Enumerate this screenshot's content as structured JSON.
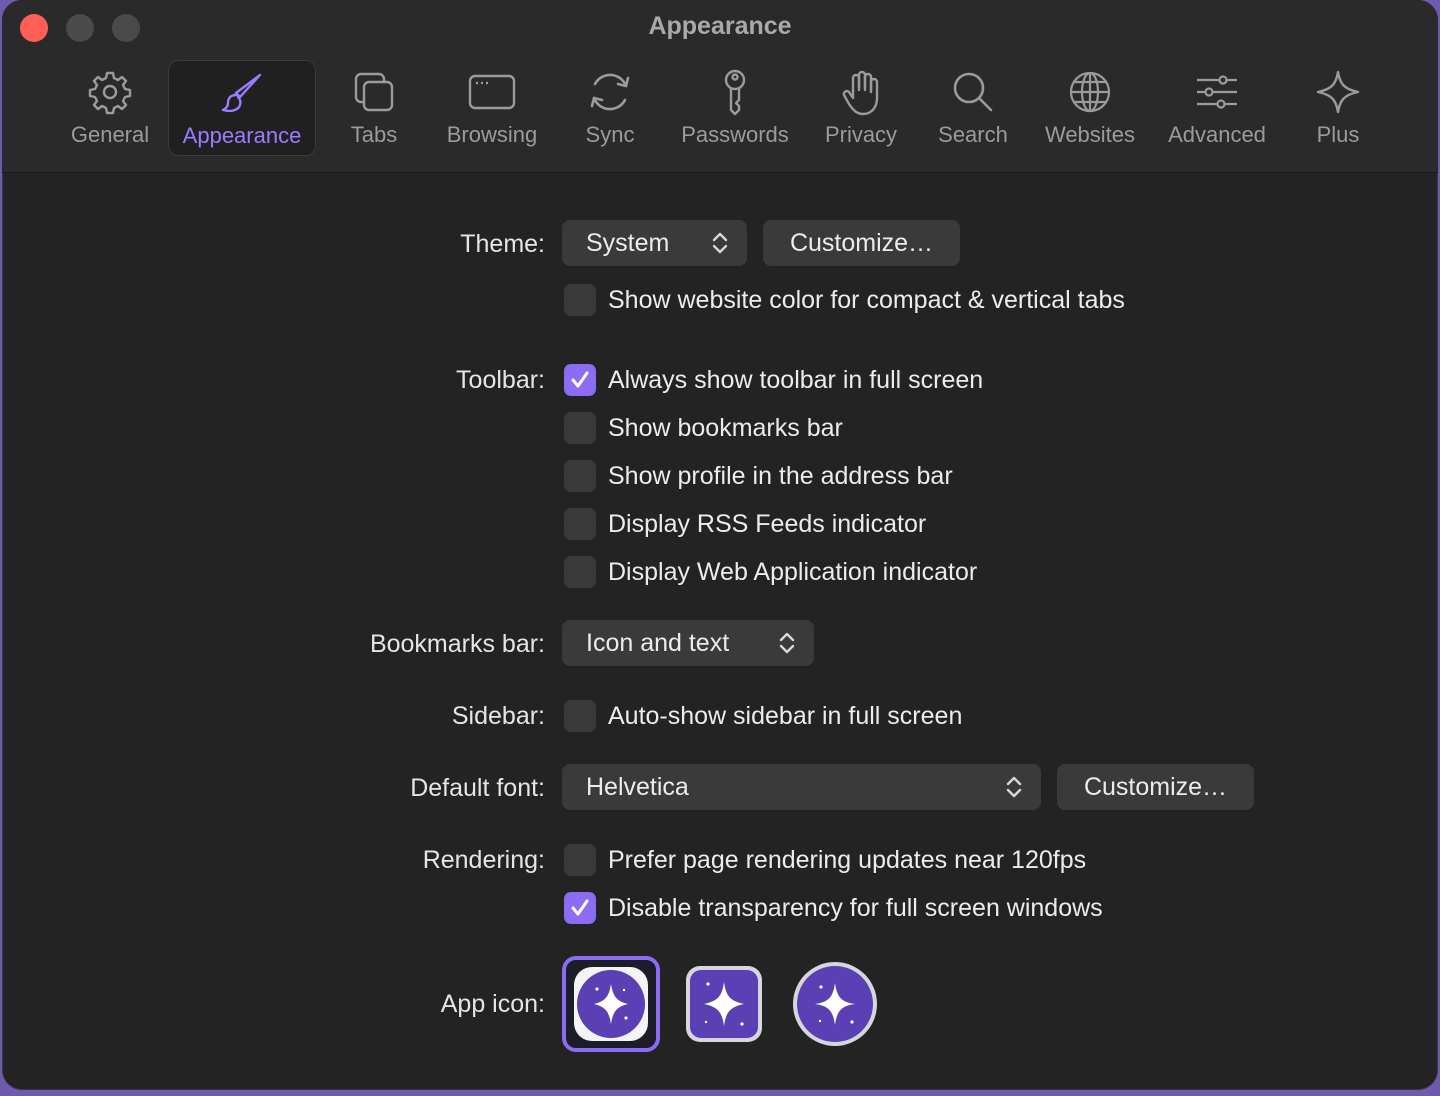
{
  "window": {
    "title": "Appearance"
  },
  "tabs": [
    {
      "label": "General",
      "icon": "gear-icon"
    },
    {
      "label": "Appearance",
      "icon": "paintbrush-icon",
      "active": true
    },
    {
      "label": "Tabs",
      "icon": "tabs-icon"
    },
    {
      "label": "Browsing",
      "icon": "browser-window-icon"
    },
    {
      "label": "Sync",
      "icon": "sync-icon"
    },
    {
      "label": "Passwords",
      "icon": "key-icon"
    },
    {
      "label": "Privacy",
      "icon": "hand-icon"
    },
    {
      "label": "Search",
      "icon": "search-icon"
    },
    {
      "label": "Websites",
      "icon": "globe-icon"
    },
    {
      "label": "Advanced",
      "icon": "sliders-icon"
    },
    {
      "label": "Plus",
      "icon": "sparkle-icon"
    }
  ],
  "theme": {
    "label": "Theme:",
    "value": "System",
    "customize": "Customize…",
    "website_color": {
      "label": "Show website color for compact & vertical tabs",
      "checked": false
    }
  },
  "toolbar": {
    "label": "Toolbar:",
    "options": [
      {
        "label": "Always show toolbar in full screen",
        "checked": true
      },
      {
        "label": "Show bookmarks bar",
        "checked": false
      },
      {
        "label": "Show profile in the address bar",
        "checked": false
      },
      {
        "label": "Display RSS Feeds indicator",
        "checked": false
      },
      {
        "label": "Display Web Application indicator",
        "checked": false
      }
    ]
  },
  "bookmarks_bar": {
    "label": "Bookmarks bar:",
    "value": "Icon and text"
  },
  "sidebar": {
    "label": "Sidebar:",
    "option": {
      "label": "Auto-show sidebar in full screen",
      "checked": false
    }
  },
  "default_font": {
    "label": "Default font:",
    "value": "Helvetica",
    "customize": "Customize…"
  },
  "rendering": {
    "label": "Rendering:",
    "options": [
      {
        "label": "Prefer page rendering updates near 120fps",
        "checked": false
      },
      {
        "label": "Disable transparency for full screen windows",
        "checked": true
      }
    ]
  },
  "app_icon": {
    "label": "App icon:",
    "selected_index": 0,
    "variants": [
      "light-circle",
      "rounded-square",
      "circle"
    ]
  },
  "colors": {
    "accent": "#8b6cf2",
    "active_tab": "#9a7dff",
    "icon_purple": "#5a3fb5"
  }
}
